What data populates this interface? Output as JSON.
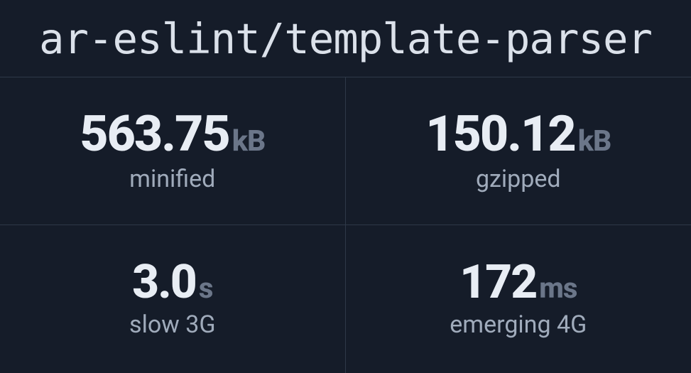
{
  "title": "ar-eslint/template-parser",
  "stats": [
    {
      "value": "563.75",
      "unit": "kB",
      "label": "minified"
    },
    {
      "value": "150.12",
      "unit": "kB",
      "label": "gzipped"
    },
    {
      "value": "3.0",
      "unit": "s",
      "label": "slow 3G"
    },
    {
      "value": "172",
      "unit": "ms",
      "label": "emerging 4G"
    }
  ]
}
